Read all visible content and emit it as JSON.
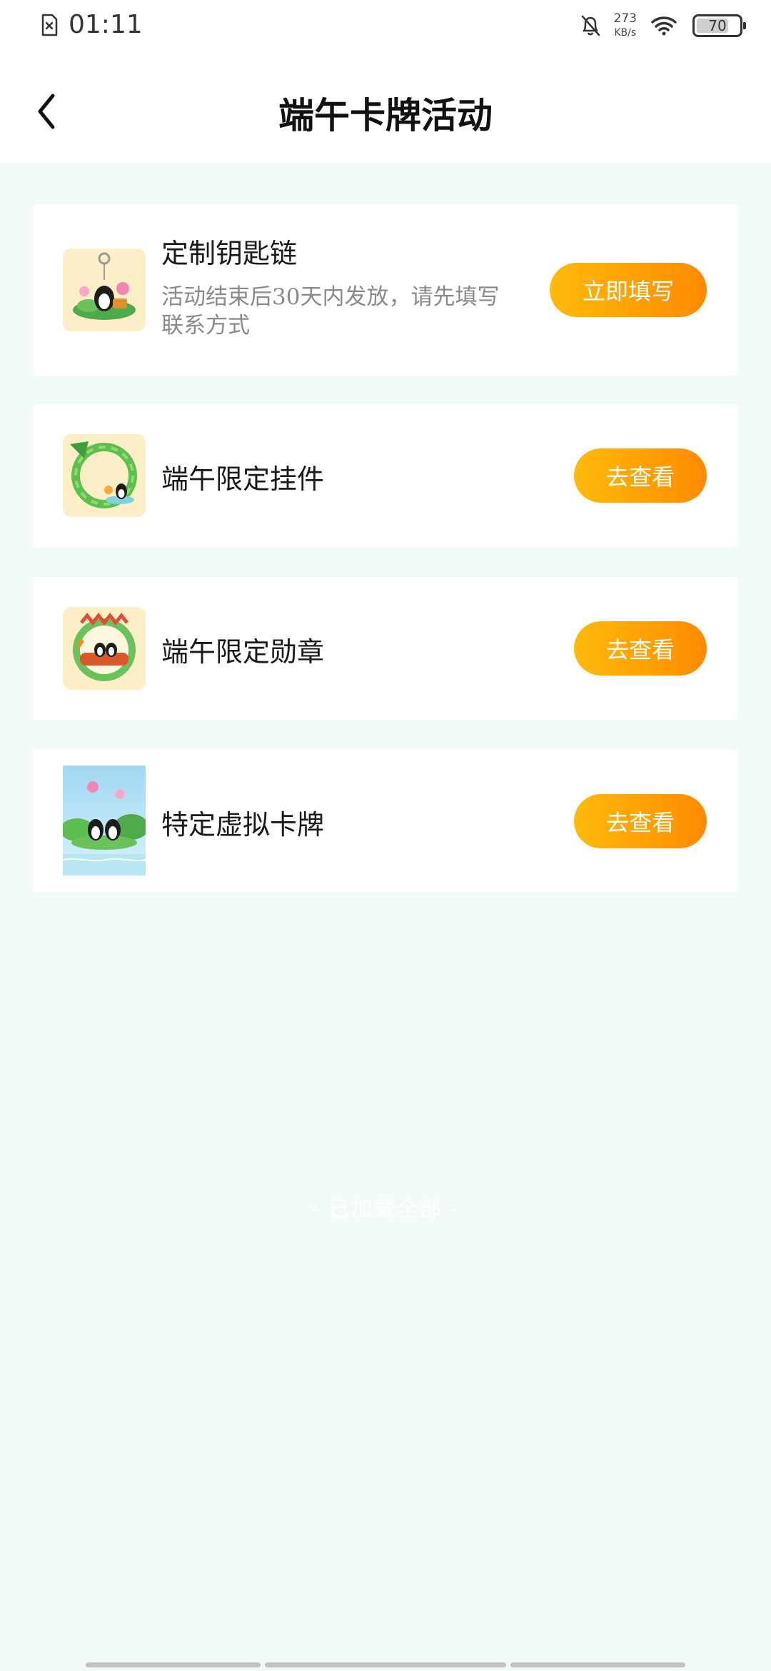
{
  "status_bar": {
    "time": "01:11",
    "net_speed_value": "273",
    "net_speed_unit": "KB/s",
    "battery_level": "70"
  },
  "header": {
    "title": "端午卡牌活动"
  },
  "rewards": [
    {
      "title": "定制钥匙链",
      "subtitle": "活动结束后30天内发放，请先填写联系方式",
      "button_label": "立即填写",
      "thumb_icon": "keychain-thumbnail"
    },
    {
      "title": "端午限定挂件",
      "button_label": "去查看",
      "thumb_icon": "pendant-thumbnail"
    },
    {
      "title": "端午限定勋章",
      "button_label": "去查看",
      "thumb_icon": "medal-thumbnail"
    },
    {
      "title": "特定虚拟卡牌",
      "button_label": "去查看",
      "thumb_icon": "card-thumbnail"
    }
  ],
  "footer": {
    "loaded_all": "- 已加载全部 -"
  },
  "colors": {
    "button_start": "#ffba0a",
    "button_end": "#ff8a00",
    "page_background": "#f2fbf6"
  }
}
